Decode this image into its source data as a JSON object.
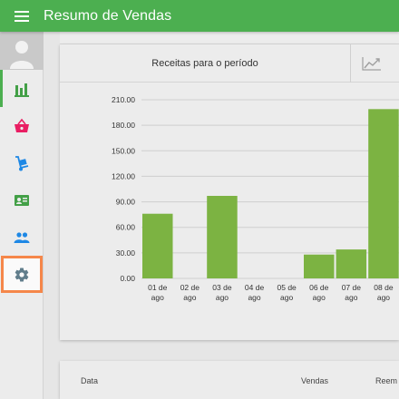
{
  "app": {
    "title": "Resumo de Vendas"
  },
  "sidebar": {
    "items": [
      {
        "icon": "bar-chart-icon",
        "active": true
      },
      {
        "icon": "basket-icon"
      },
      {
        "icon": "hand-truck-icon"
      },
      {
        "icon": "id-card-icon"
      },
      {
        "icon": "people-icon"
      },
      {
        "icon": "gear-icon",
        "highlighted": true
      }
    ]
  },
  "colors": {
    "primary": "#4caf50",
    "bar": "#7cb342",
    "highlight": "#f5874a"
  },
  "card": {
    "title": "Receitas para o período",
    "chart_toggle_icon": "trending-up-icon"
  },
  "chart_data": {
    "type": "bar",
    "title": "",
    "xlabel": "",
    "ylabel": "",
    "ylim": [
      0,
      210
    ],
    "yticks": [
      "0.00",
      "30.00",
      "60.00",
      "90.00",
      "120.00",
      "150.00",
      "180.00",
      "210.00"
    ],
    "categories": [
      [
        "01 de",
        "ago"
      ],
      [
        "02 de",
        "ago"
      ],
      [
        "03 de",
        "ago"
      ],
      [
        "04 de",
        "ago"
      ],
      [
        "05 de",
        "ago"
      ],
      [
        "06 de",
        "ago"
      ],
      [
        "07 de",
        "ago"
      ],
      [
        "08 de",
        "ago"
      ]
    ],
    "values": [
      76,
      0,
      97,
      0,
      0,
      28,
      34,
      199
    ],
    "grid": true
  },
  "table": {
    "headers": [
      "Data",
      "Vendas",
      "Reem"
    ]
  }
}
